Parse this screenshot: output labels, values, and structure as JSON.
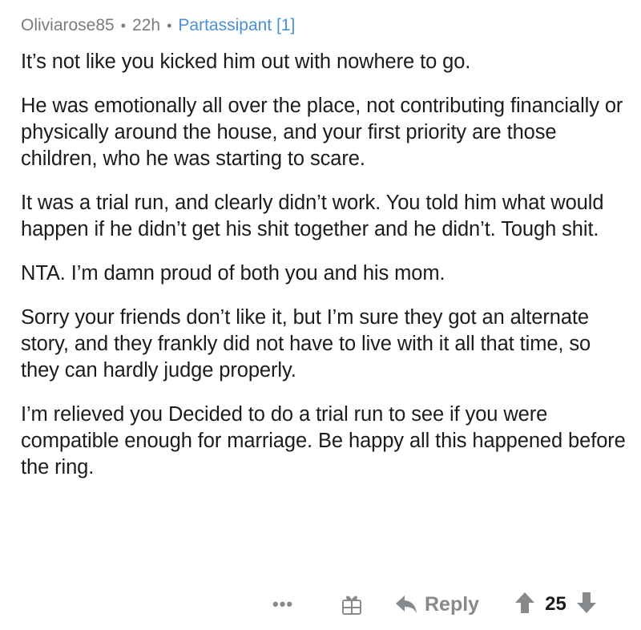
{
  "comment": {
    "username": "Oliviarose85",
    "separator": "•",
    "age": "22h",
    "flair": "Partassipant [1]",
    "paragraphs": [
      "It’s not like you kicked him out with nowhere to go.",
      "He was emotionally all over the place, not contributing financially or physically around the house, and your first priority are those children, who he was starting to scare.",
      "It was a trial run, and clearly didn’t work. You told him what would happen if he didn’t get his shit together and he didn’t. Tough shit.",
      "NTA. I’m damn proud of both you and his mom.",
      "Sorry your friends don’t like it, but I’m sure they got an alternate story, and they frankly did not have to live with it all that time, so they can hardly judge properly.",
      "I’m relieved you Decided to do a trial run to see if you were compatible enough for marriage. Be happy all this happened before the ring."
    ]
  },
  "actions": {
    "more": "•••",
    "award_icon": "gift-icon",
    "reply_label": "Reply",
    "score": "25"
  },
  "colors": {
    "meta_gray": "#7c7c7c",
    "flair_blue": "#4a90d9",
    "icon_gray": "#878a8c",
    "text": "#1c1c1c"
  }
}
